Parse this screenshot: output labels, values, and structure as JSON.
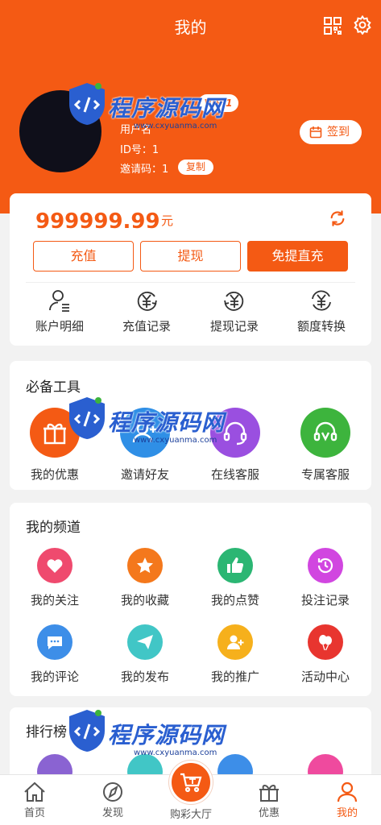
{
  "header": {
    "title": "我的",
    "vip_label": "VIP 1",
    "user_name": "用户名",
    "id_label": "ID号：1",
    "invite_label": "邀请码：1",
    "copy_label": "复制",
    "signin_label": "签到"
  },
  "wallet": {
    "balance": "999999.99",
    "unit": "元",
    "buttons": [
      "充值",
      "提现",
      "免提直充"
    ],
    "items": [
      "账户明细",
      "充值记录",
      "提现记录",
      "额度转换"
    ]
  },
  "tools": {
    "title": "必备工具",
    "items": [
      "我的优惠",
      "邀请好友",
      "在线客服",
      "专属客服"
    ]
  },
  "channel": {
    "title": "我的频道",
    "items": [
      "我的关注",
      "我的收藏",
      "我的点赞",
      "投注记录",
      "我的评论",
      "我的发布",
      "我的推广",
      "活动中心"
    ]
  },
  "ranking": {
    "title": "排行榜"
  },
  "tabbar": {
    "items": [
      "首页",
      "发现",
      "购彩大厅",
      "优惠",
      "我的"
    ],
    "active": "我的"
  },
  "watermark": {
    "text": "程序源码网",
    "url": "www.cxyuanma.com"
  },
  "colors": {
    "brand": "#f45a14",
    "background": "#f2f2f2"
  }
}
